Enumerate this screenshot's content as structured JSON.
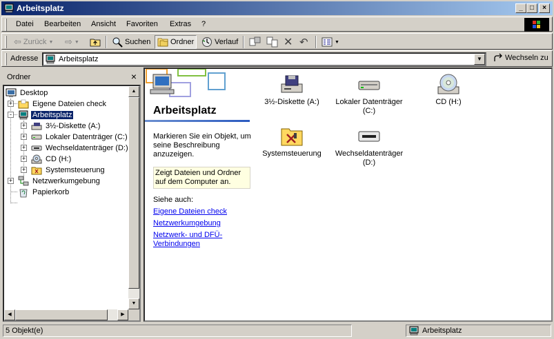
{
  "window": {
    "title": "Arbeitsplatz"
  },
  "titlebar_buttons": [
    "_",
    "□",
    "×"
  ],
  "menu": [
    "Datei",
    "Bearbeiten",
    "Ansicht",
    "Favoriten",
    "Extras",
    "?"
  ],
  "toolbar": {
    "back": "Zurück",
    "search": "Suchen",
    "folders": "Ordner",
    "history": "Verlauf"
  },
  "address": {
    "label": "Adresse",
    "value": "Arbeitsplatz",
    "go": "Wechseln zu"
  },
  "folder_pane": {
    "title": "Ordner",
    "close": "×",
    "tree": [
      {
        "label": "Desktop",
        "icon": "desktop-icon",
        "expander": ""
      },
      {
        "label": "Eigene Dateien check",
        "icon": "folder-icon",
        "expander": "+"
      },
      {
        "label": "Arbeitsplatz",
        "icon": "computer-icon",
        "expander": "-",
        "selected": true
      },
      {
        "label": "3½-Diskette (A:)",
        "icon": "floppy-icon",
        "expander": "+"
      },
      {
        "label": "Lokaler Datenträger (C:)",
        "icon": "hard-drive-icon",
        "expander": "+"
      },
      {
        "label": "Wechseldatenträger (D:)",
        "icon": "removable-drive-icon",
        "expander": "+"
      },
      {
        "label": "CD (H:)",
        "icon": "cd-drive-icon",
        "expander": "+"
      },
      {
        "label": "Systemsteuerung",
        "icon": "control-panel-icon",
        "expander": "+"
      },
      {
        "label": "Netzwerkumgebung",
        "icon": "network-icon",
        "expander": "+"
      },
      {
        "label": "Papierkorb",
        "icon": "recycle-bin-icon",
        "expander": ""
      }
    ]
  },
  "webview": {
    "title": "Arbeitsplatz",
    "description": "Markieren Sie ein Objekt, um seine Beschreibung anzuzeigen.",
    "info": "Zeigt Dateien und Ordner auf dem Computer an.",
    "see_also": "Siehe auch:",
    "links": [
      "Eigene Dateien check",
      "Netzwerkumgebung",
      "Netzwerk- und DFÜ-Verbindungen"
    ]
  },
  "items": [
    {
      "label": "3½-Diskette (A:)",
      "icon": "floppy-drive-icon"
    },
    {
      "label": "Lokaler Datenträger (C:)",
      "icon": "hard-drive-icon"
    },
    {
      "label": "CD (H:)",
      "icon": "cd-drive-icon"
    },
    {
      "label": "Systemsteuerung",
      "icon": "control-panel-icon"
    },
    {
      "label": "Wechseldatenträger (D:)",
      "icon": "removable-drive-icon"
    }
  ],
  "status": {
    "count": "5 Objekt(e)",
    "location": "Arbeitsplatz"
  },
  "colors": {
    "titlebar": "#0a246a",
    "selection": "#0a246a",
    "link": "#0000ee",
    "face": "#d4d0c8"
  }
}
